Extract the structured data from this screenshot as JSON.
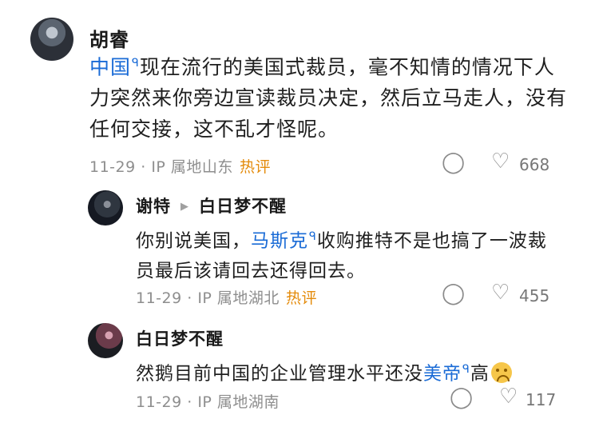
{
  "comments": [
    {
      "author": "胡睿",
      "text_link": "中国",
      "text_rest": "现在流行的美国式裁员，毫不知情的情况下人力突然来你旁边宣读裁员决定，然后立马走人，没有任何交接，这不乱才怪呢。",
      "meta": "11-29 · IP 属地山东",
      "hot": "热评",
      "likes": "668"
    },
    {
      "author": "谢特",
      "reply_to": "白日梦不醒",
      "text_pre": "你别说美国，",
      "text_link": "马斯克",
      "text_rest": "收购推特不是也搞了一波裁员最后该请回去还得回去。",
      "meta": "11-29 · IP 属地湖北",
      "hot": "热评",
      "likes": "455"
    },
    {
      "author": "白日梦不醒",
      "text_pre": "然鹅目前中国的企业管理水平还没",
      "text_link": "美帝",
      "text_rest": "高",
      "meta": "11-29 · IP 属地湖南",
      "likes": "117"
    }
  ],
  "icons": {
    "comment": "comment-bubble-icon",
    "like": "heart-icon",
    "search_tag": "search-tag-icon",
    "reply_arrow": "triangle-right-icon",
    "emoji": "crying-face-emoji"
  },
  "colors": {
    "link": "#1a6bd6",
    "hot": "#e48b0b",
    "meta": "#8e8e8e"
  }
}
